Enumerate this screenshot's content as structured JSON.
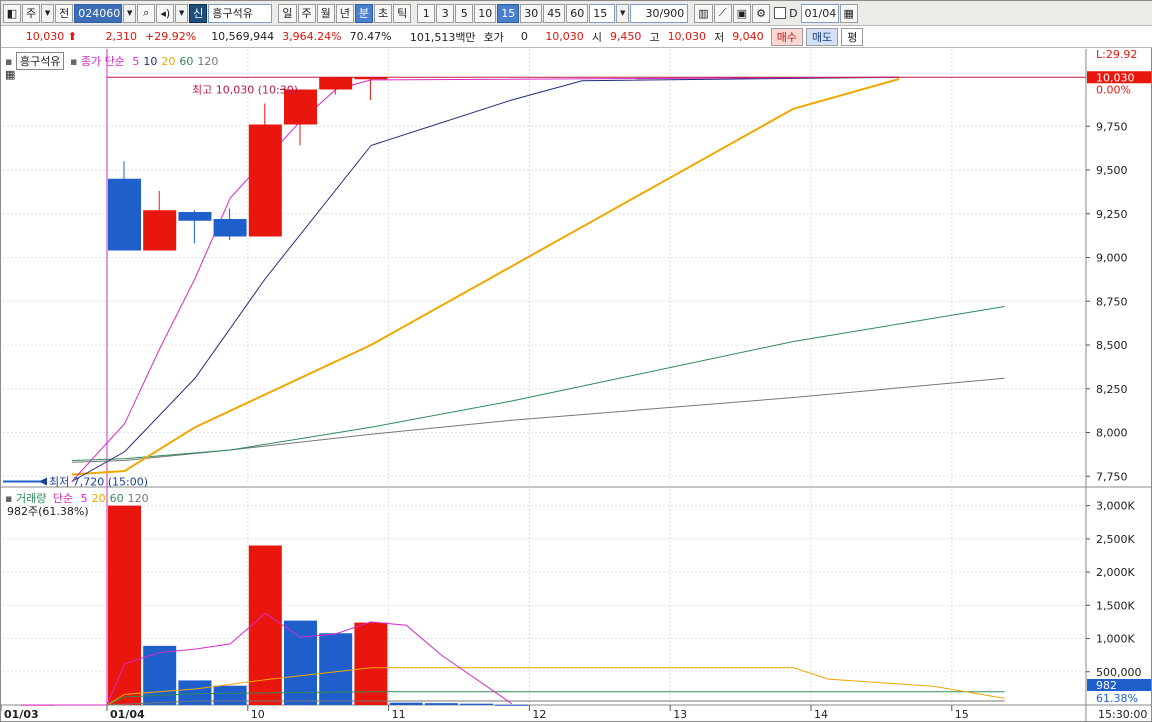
{
  "toolbar": {
    "period_label": "주",
    "prev_label": "전",
    "stock_code": "024060",
    "new_tag": "신",
    "stock_name": "흥구석유",
    "periods": [
      "일",
      "주",
      "월",
      "년",
      "분",
      "초",
      "틱"
    ],
    "minutes": [
      "1",
      "3",
      "5",
      "10",
      "15",
      "30",
      "45",
      "60"
    ],
    "selected_period": "분",
    "selected_minute": "15",
    "interval_value": "15",
    "count_value": "30/900",
    "date_label": "D",
    "date_value": "01/04"
  },
  "quote": {
    "price": "10,030",
    "change": "2,310",
    "change_pct": "+29.92%",
    "volume": "10,569,944",
    "volume_ratio": "3,964.24%",
    "turnover_pct": "70.47%",
    "amount": "101,513백만",
    "ask_label": "호가",
    "ask_value": "0",
    "last": "10,030",
    "open_label": "시",
    "open": "9,450",
    "high_label": "고",
    "high": "10,030",
    "low_label": "저",
    "low": "9,040",
    "buy_label": "매수",
    "sell_label": "매도",
    "avg_label": "평"
  },
  "price_chart": {
    "stock_label": "흥구석유",
    "ma_label": "종가 단순",
    "ma_periods": [
      "5",
      "10",
      "20",
      "60",
      "120"
    ],
    "hi_annotation": "최고 10,030 (10:30)",
    "lo_annotation": "최저 7,720 (15:00)",
    "top_label": "L:29.92",
    "price_tag": "10,030",
    "pct_tag": "0.00%",
    "y_ticks": [
      "9,750",
      "9,500",
      "9,250",
      "9,000",
      "8,750",
      "8,500",
      "8,250",
      "8,000",
      "7,750"
    ]
  },
  "volume_chart": {
    "label": "거래량",
    "ma_label": "단순",
    "ma_periods": [
      "5",
      "20",
      "60",
      "120"
    ],
    "current": "982주(61.38%)",
    "y_ticks": [
      "3,000K",
      "2,500K",
      "2,000K",
      "1,500K",
      "1,000K",
      "500,000"
    ],
    "vol_tag": "982",
    "pct_tag": "61.38%"
  },
  "x_axis": {
    "labels": [
      "01/03",
      "01/04",
      "10",
      "11",
      "12",
      "13",
      "14",
      "15"
    ],
    "time_label": "15:30:00"
  },
  "colors": {
    "up": "#e8160c",
    "down": "#1f5fcc",
    "ma5": "#d62ac8",
    "ma10": "#1c2f7a",
    "ma20": "#f0a800",
    "ma60": "#2e8b57",
    "ma120": "#777777"
  },
  "chart_data": [
    {
      "type": "candlestick",
      "title": "흥구석유",
      "categories": [
        "01/03 15:00",
        "01/04 09:15",
        "09:30",
        "09:45",
        "10:00",
        "10:15",
        "10:30",
        "10:45",
        "11:00"
      ],
      "candles": [
        {
          "open": 7720,
          "high": 7720,
          "low": 7720,
          "close": 7720
        },
        {
          "open": 9450,
          "high": 9550,
          "low": 9040,
          "close": 9040
        },
        {
          "open": 9040,
          "high": 9380,
          "low": 9040,
          "close": 9270
        },
        {
          "open": 9260,
          "high": 9270,
          "low": 9080,
          "close": 9210
        },
        {
          "open": 9220,
          "high": 9280,
          "low": 9100,
          "close": 9120
        },
        {
          "open": 9120,
          "high": 9880,
          "low": 9120,
          "close": 9760
        },
        {
          "open": 9760,
          "high": 9960,
          "low": 9640,
          "close": 9960
        },
        {
          "open": 9960,
          "high": 10030,
          "low": 9930,
          "close": 10030
        },
        {
          "open": 10030,
          "high": 10030,
          "low": 9900,
          "close": 10030
        }
      ],
      "ma": {
        "ma5": [
          {
            "x": "01/03 15:00",
            "y": 7720
          },
          {
            "x": "01/04 09:15",
            "y": 8050
          },
          {
            "x": "09:30",
            "y": 8480
          },
          {
            "x": "09:45",
            "y": 8880
          },
          {
            "x": "10:00",
            "y": 9340
          },
          {
            "x": "10:15",
            "y": 9560
          },
          {
            "x": "10:30",
            "y": 9780
          },
          {
            "x": "10:45",
            "y": 9960
          },
          {
            "x": "11:00",
            "y": 10015
          },
          {
            "x": "14:45",
            "y": 10030
          }
        ],
        "ma10": [
          {
            "x": "01/03 15:00",
            "y": 7720
          },
          {
            "x": "01/04 09:15",
            "y": 7890
          },
          {
            "x": "09:45",
            "y": 8310
          },
          {
            "x": "10:15",
            "y": 8880
          },
          {
            "x": "11:00",
            "y": 9640
          },
          {
            "x": "12:00",
            "y": 9900
          },
          {
            "x": "12:30",
            "y": 10010
          },
          {
            "x": "14:45",
            "y": 10030
          }
        ],
        "ma20": [
          {
            "x": "01/03 15:00",
            "y": 7760
          },
          {
            "x": "01/04 09:15",
            "y": 7780
          },
          {
            "x": "09:45",
            "y": 8030
          },
          {
            "x": "11:00",
            "y": 8500
          },
          {
            "x": "12:00",
            "y": 8950
          },
          {
            "x": "14:00",
            "y": 9850
          },
          {
            "x": "14:45",
            "y": 10020
          }
        ],
        "ma60": [
          {
            "x": "01/03 15:00",
            "y": 7840
          },
          {
            "x": "01/04 09:15",
            "y": 7850
          },
          {
            "x": "10:00",
            "y": 7900
          },
          {
            "x": "11:00",
            "y": 8030
          },
          {
            "x": "12:00",
            "y": 8180
          },
          {
            "x": "14:00",
            "y": 8520
          },
          {
            "x": "15:30",
            "y": 8720
          }
        ],
        "ma120": [
          {
            "x": "01/03 15:00",
            "y": 7830
          },
          {
            "x": "01/04 09:15",
            "y": 7840
          },
          {
            "x": "10:00",
            "y": 7900
          },
          {
            "x": "11:00",
            "y": 7990
          },
          {
            "x": "12:00",
            "y": 8070
          },
          {
            "x": "14:00",
            "y": 8200
          },
          {
            "x": "15:30",
            "y": 8310
          }
        ]
      },
      "ylim": [
        7700,
        10100
      ],
      "grid": true
    },
    {
      "type": "bar",
      "title": "거래량",
      "categories": [
        "01/03 15:00",
        "01/04 09:15",
        "09:30",
        "09:45",
        "10:00",
        "10:15",
        "10:30",
        "10:45",
        "11:00",
        "11:15",
        "11:30",
        "11:45",
        "12:00"
      ],
      "values": [
        5000,
        3000000,
        890000,
        370000,
        290000,
        2400000,
        1270000,
        1080000,
        1240000,
        35000,
        28000,
        20000,
        3000
      ],
      "directions": [
        "up",
        "up",
        "down",
        "down",
        "down",
        "up",
        "down",
        "down",
        "up",
        "down",
        "down",
        "down",
        "down"
      ],
      "ma": {
        "ma5": [
          {
            "x": "01/03 15:00",
            "y": 0
          },
          {
            "x": "01/04 09:00",
            "y": 0
          },
          {
            "x": "01/04 09:15",
            "y": 620000
          },
          {
            "x": "09:30",
            "y": 790000
          },
          {
            "x": "09:45",
            "y": 840000
          },
          {
            "x": "10:00",
            "y": 920000
          },
          {
            "x": "10:15",
            "y": 1380000
          },
          {
            "x": "10:30",
            "y": 1020000
          },
          {
            "x": "10:45",
            "y": 1070000
          },
          {
            "x": "11:00",
            "y": 1250000
          },
          {
            "x": "11:15",
            "y": 1200000
          },
          {
            "x": "11:30",
            "y": 750000
          },
          {
            "x": "12:00",
            "y": 20000
          }
        ],
        "ma20": [
          {
            "x": "01/04 09:00",
            "y": 0
          },
          {
            "x": "01/04 09:15",
            "y": 160000
          },
          {
            "x": "09:45",
            "y": 240000
          },
          {
            "x": "10:15",
            "y": 380000
          },
          {
            "x": "11:00",
            "y": 560000
          },
          {
            "x": "14:00",
            "y": 560000
          },
          {
            "x": "14:15",
            "y": 390000
          },
          {
            "x": "15:00",
            "y": 280000
          },
          {
            "x": "15:30",
            "y": 100000
          }
        ],
        "ma60": [
          {
            "x": "01/04 09:00",
            "y": 0
          },
          {
            "x": "01/04 09:15",
            "y": 120000
          },
          {
            "x": "09:45",
            "y": 170000
          },
          {
            "x": "11:00",
            "y": 200000
          },
          {
            "x": "15:30",
            "y": 200000
          }
        ],
        "ma120": [
          {
            "x": "01/04 09:00",
            "y": 0
          },
          {
            "x": "09:45",
            "y": 60000
          },
          {
            "x": "15:30",
            "y": 60000
          }
        ]
      },
      "ylim": [
        0,
        3100000
      ],
      "grid": true
    }
  ]
}
